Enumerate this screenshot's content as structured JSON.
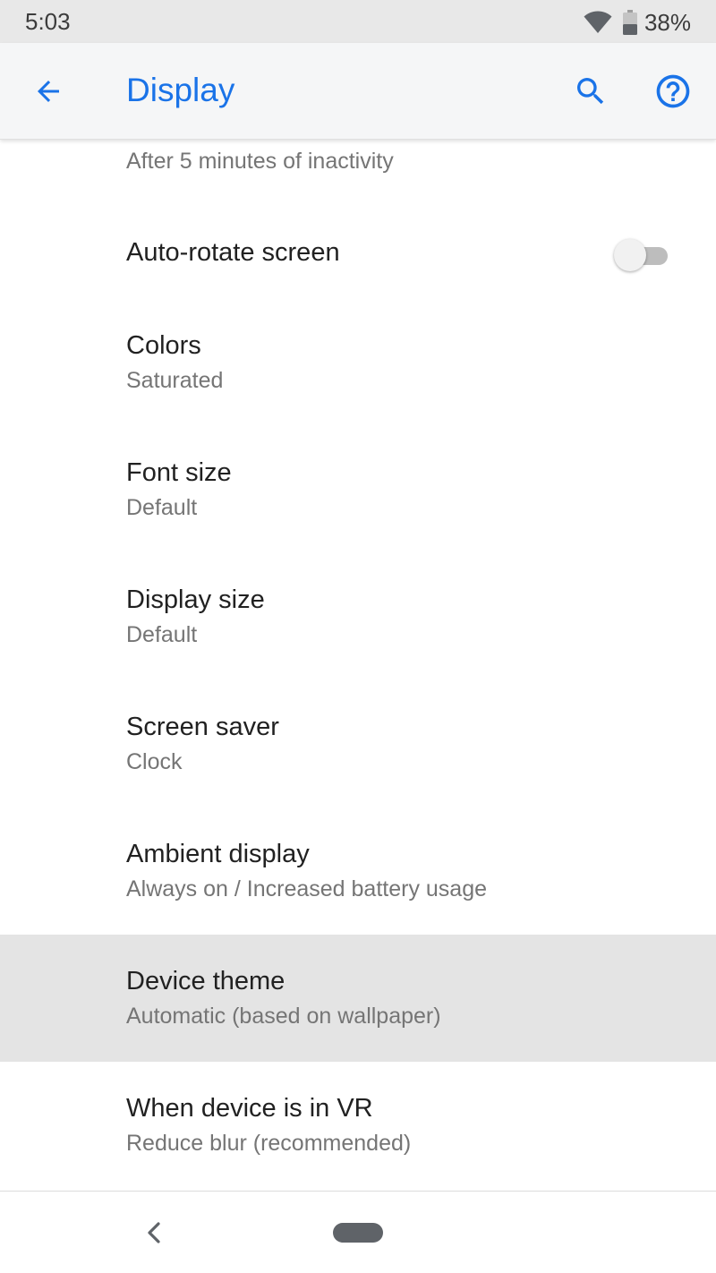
{
  "status_bar": {
    "time": "5:03",
    "battery_percent": "38%",
    "icons": [
      "wifi-icon",
      "battery-icon"
    ]
  },
  "app_bar": {
    "title": "Display",
    "icons": [
      "back-arrow-icon",
      "search-icon",
      "help-icon"
    ],
    "accent_color": "#1a73e8"
  },
  "settings": {
    "partial_item": {
      "summary": "After 5 minutes of inactivity"
    },
    "auto_rotate": {
      "title": "Auto-rotate screen",
      "enabled": false
    },
    "items": [
      {
        "title": "Colors",
        "summary": "Saturated"
      },
      {
        "title": "Font size",
        "summary": "Default"
      },
      {
        "title": "Display size",
        "summary": "Default"
      },
      {
        "title": "Screen saver",
        "summary": "Clock"
      },
      {
        "title": "Ambient display",
        "summary": "Always on / Increased battery usage"
      },
      {
        "title": "Device theme",
        "summary": "Automatic (based on wallpaper)",
        "pressed": true
      },
      {
        "title": "When device is in VR",
        "summary": "Reduce blur (recommended)"
      }
    ]
  },
  "nav_bar": {
    "icons": [
      "nav-back-icon",
      "home-pill-icon"
    ]
  }
}
